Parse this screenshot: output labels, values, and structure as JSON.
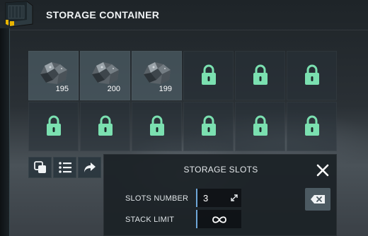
{
  "header": {
    "title": "STORAGE CONTAINER",
    "icon": "container-icon"
  },
  "colors": {
    "lock": "#7be0b0",
    "accent": "#6fa7d8"
  },
  "slots": [
    {
      "state": "filled",
      "item": "ore-icon",
      "count": "195"
    },
    {
      "state": "filled",
      "item": "ore-icon",
      "count": "200"
    },
    {
      "state": "filled",
      "item": "ore-icon",
      "count": "199"
    },
    {
      "state": "locked"
    },
    {
      "state": "locked"
    },
    {
      "state": "locked"
    },
    {
      "state": "locked"
    },
    {
      "state": "locked"
    },
    {
      "state": "locked"
    },
    {
      "state": "locked"
    },
    {
      "state": "locked"
    },
    {
      "state": "locked"
    }
  ],
  "toolbar": {
    "buttons": [
      "stack-icon",
      "list-icon",
      "share-icon"
    ]
  },
  "panel": {
    "title": "STORAGE SLOTS",
    "slots_number_label": "SLOTS NUMBER",
    "slots_number_value": "3",
    "stack_limit_label": "STACK LIMIT",
    "stack_limit_value": "∞"
  }
}
